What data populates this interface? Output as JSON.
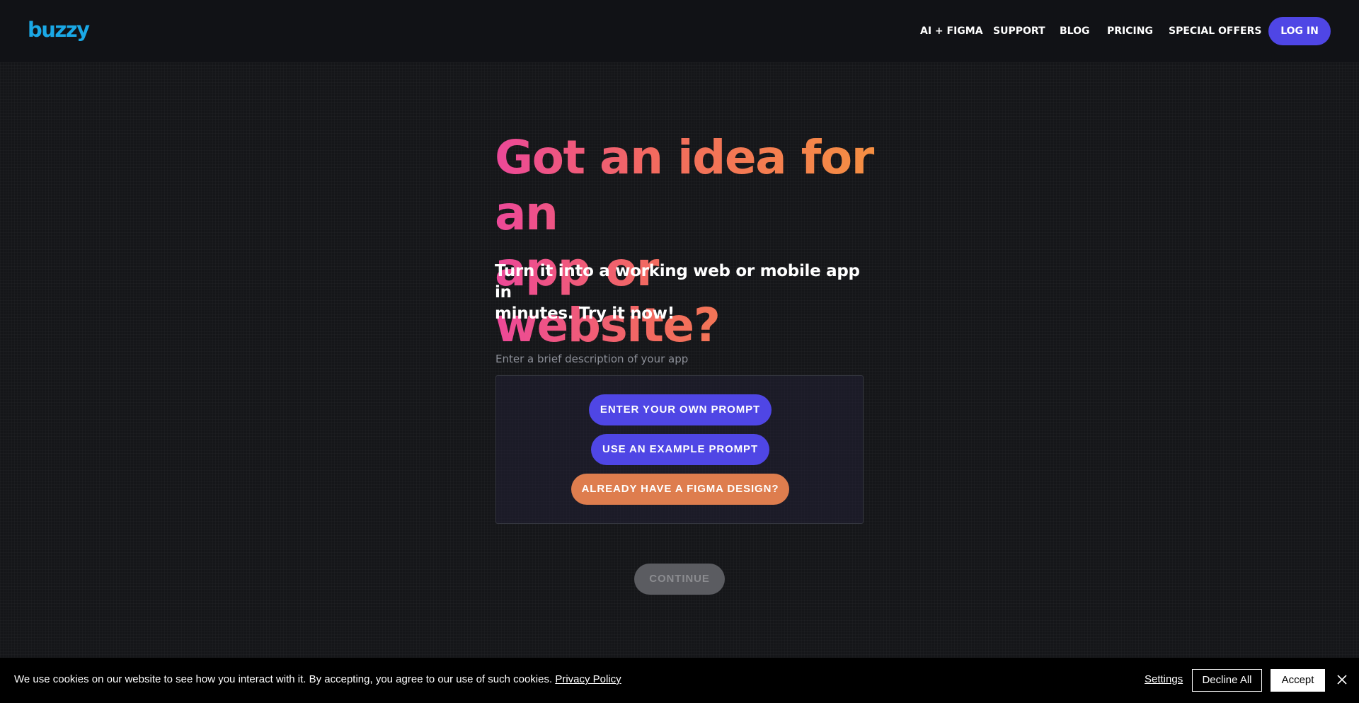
{
  "header": {
    "logo_text": "buzzy",
    "nav": [
      "AI + FIGMA",
      "SUPPORT",
      "BLOG",
      "PRICING",
      "SPECIAL OFFERS"
    ],
    "login_label": "LOG IN"
  },
  "hero": {
    "title_line1": "Got an idea for an",
    "title_line2": "app or website?",
    "subtitle_line1": "Turn it into a working web or mobile app in",
    "subtitle_line2": "minutes. Try it now!"
  },
  "prompt": {
    "label": "Enter a brief description of your app",
    "own_prompt_label": "ENTER YOUR OWN PROMPT",
    "example_prompt_label": "USE AN EXAMPLE PROMPT",
    "figma_label": "ALREADY HAVE A FIGMA DESIGN?",
    "continue_label": "CONTINUE"
  },
  "cookie": {
    "message": "We use cookies on our website to see how you interact with it. By accepting, you agree to our use of such cookies.",
    "policy_link": "Privacy Policy",
    "settings_label": "Settings",
    "decline_label": "Decline All",
    "accept_label": "Accept"
  },
  "colors": {
    "brand_logo": "#1aa8e6",
    "primary_button": "#4f46e5",
    "figma_button": "#de7d4e",
    "title_gradient_start": "#ec4899",
    "title_gradient_end": "#f59240"
  },
  "icons": {
    "close": "close-icon"
  }
}
